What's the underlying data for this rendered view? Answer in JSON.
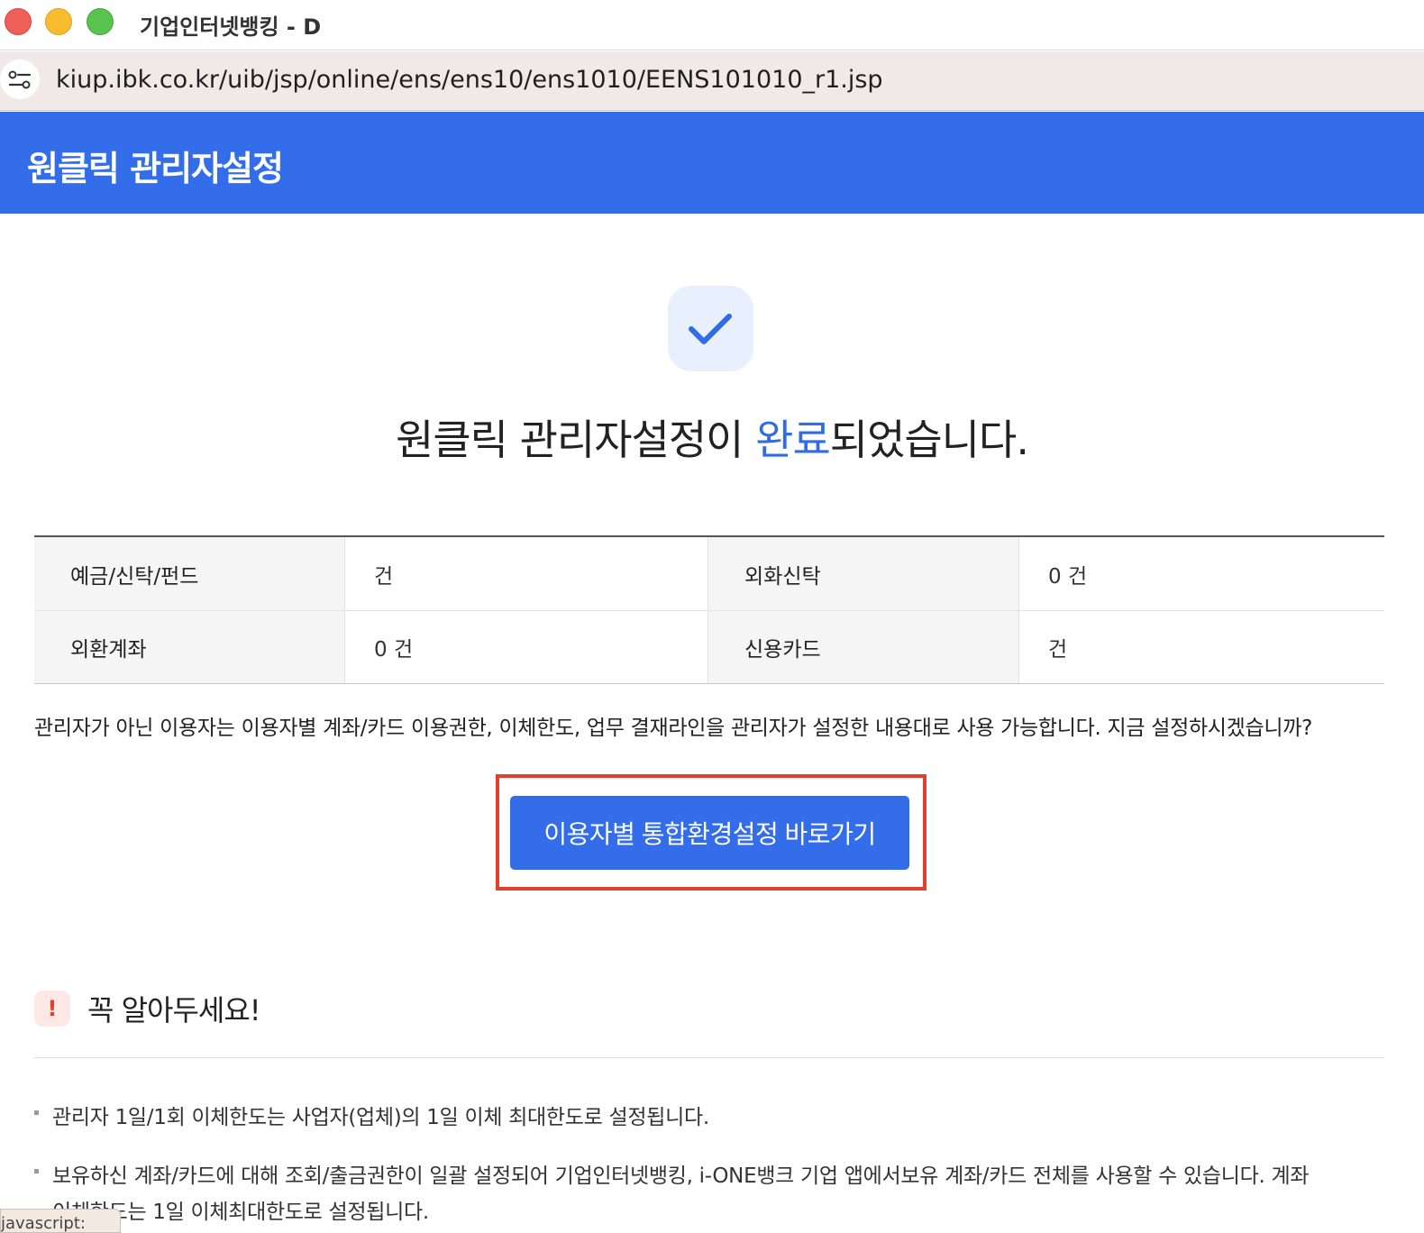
{
  "window": {
    "title": "기업인터넷뱅킹 - D"
  },
  "address_bar": {
    "url": "kiup.ibk.co.kr/uib/jsp/online/ens/ens10/ens1010/EENS101010_r1.jsp"
  },
  "banner": {
    "title": "원클릭 관리자설정"
  },
  "completion": {
    "prefix": "원클릭 관리자설정이 ",
    "highlight": "완료",
    "suffix": "되었습니다.",
    "accent_color": "#2f6ce5"
  },
  "summary": {
    "rows": [
      {
        "label1": "예금/신탁/펀드",
        "value1": "건",
        "label2": "외화신탁",
        "value2": "0 건"
      },
      {
        "label1": "외환계좌",
        "value1": "0 건",
        "label2": "신용카드",
        "value2": "건"
      }
    ]
  },
  "notice_line": "관리자가 아닌 이용자는 이용자별 계좌/카드 이용권한, 이체한도, 업무 결재라인을 관리자가 설정한 내용대로 사용 가능합니다. 지금 설정하시겠습니까?",
  "goto_button": {
    "label": "이용자별 통합환경설정 바로가기",
    "color": "#336de9"
  },
  "highlight_color": "#e2402f",
  "warning": {
    "icon": "!",
    "title": "꼭 알아두세요!",
    "bullets": [
      "관리자 1일/1회 이체한도는 사업자(업체)의 1일 이체 최대한도로 설정됩니다.",
      "보유하신 계좌/카드에 대해 조회/출금권한이 일괄 설정되어 기업인터넷뱅킹, i-ONE뱅크 기업 앱에서보유 계좌/카드 전체를 사용할 수 있습니다. 계좌",
      "이체한도는 1일 이체최대한도로 설정됩니다."
    ]
  },
  "status_tab": {
    "text": "javascript:"
  },
  "colors": {
    "banner": "#336de9",
    "traffic_red": "#ee5f58",
    "traffic_yellow": "#f8bd2f",
    "traffic_green": "#5ac24e"
  }
}
